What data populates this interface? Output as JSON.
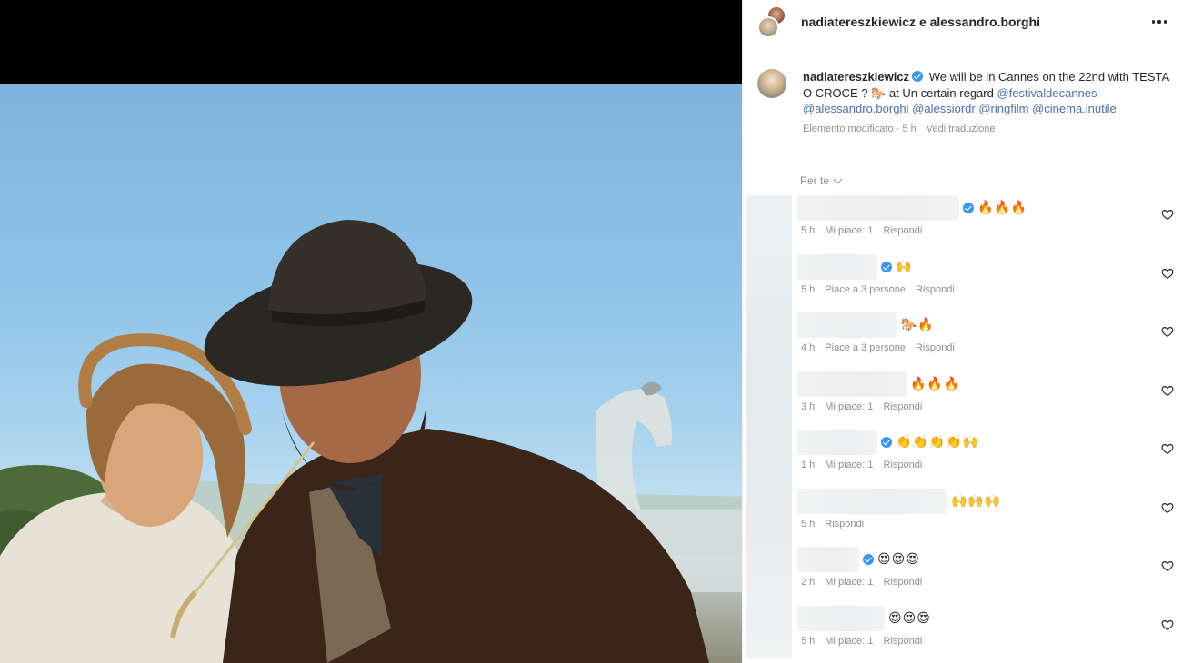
{
  "post": {
    "header_title": "nadiatereszkiewicz e alessandro.borghi",
    "more_icon": "more-horizontal-icon",
    "caption": {
      "username": "nadiatereszkiewicz",
      "text_1": "We will be in Cannes on the 22nd with TESTA O CROCE ?",
      "emoji_1": "🐎",
      "text_2": "at Un certain regard",
      "mentions": [
        "@festivaldecannes",
        "@alessandro.borghi",
        "@alessiordr",
        "@ringfilm",
        "@cinema.inutile"
      ],
      "edited": "Elemento modificato · 5 h",
      "translate": "Vedi traduzione"
    },
    "sort_label": "Per te",
    "reply_label": "Rispondi",
    "comments": [
      {
        "emojis": "🔥🔥🔥",
        "time": "5 h",
        "likes": "Mi piace: 1",
        "verified": true
      },
      {
        "emojis": "🙌",
        "time": "5 h",
        "likes": "Piace a 3 persone",
        "verified": true
      },
      {
        "emojis": "🐎🔥",
        "time": "4 h",
        "likes": "Piace a 3 persone",
        "verified": false
      },
      {
        "emojis": "🔥🔥🔥",
        "time": "3 h",
        "likes": "Mi piace: 1",
        "verified": false
      },
      {
        "emojis": "👏👏👏👏🙌",
        "time": "1 h",
        "likes": "Mi piace: 1",
        "verified": true
      },
      {
        "emojis": "🙌🙌🙌",
        "time": "5 h",
        "likes": "",
        "verified": false
      },
      {
        "emojis": "😍😍😍",
        "time": "2 h",
        "likes": "Mi piace: 1",
        "verified": true
      },
      {
        "emojis": "😍😍😍",
        "time": "5 h",
        "likes": "Mi piace: 1",
        "verified": false
      }
    ]
  },
  "colors": {
    "link": "#4a6fb0",
    "verified": "#3897f0",
    "muted": "#8e8e8e"
  }
}
